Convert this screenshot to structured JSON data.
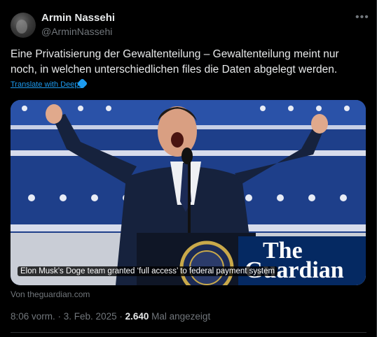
{
  "author": {
    "name": "Armin Nassehi",
    "handle": "@ArminNassehi"
  },
  "more_icon": "more-horizontal-icon",
  "tweet_text": "Eine Privatisierung der Gewaltenteilung – Gewaltenteilung meint nur noch, in welchen unterschiedlichen files die Daten abgelegt werden.",
  "translate_label": "Translate with DeepL",
  "card": {
    "caption": "Elon Musk’s Doge team granted ‘full access’ to federal payment system",
    "logo_line1": "The",
    "logo_line2": "Guardian",
    "source": "Von theguardian.com"
  },
  "meta": {
    "time": "8:06 vorm.",
    "sep1": " · ",
    "date": "3. Feb. 2025",
    "sep2": " · ",
    "views": "2.640",
    "views_label": " Mal angezeigt"
  },
  "colors": {
    "accent": "#1d9bf0",
    "muted": "#71767b",
    "guardian_blue": "#052962"
  }
}
